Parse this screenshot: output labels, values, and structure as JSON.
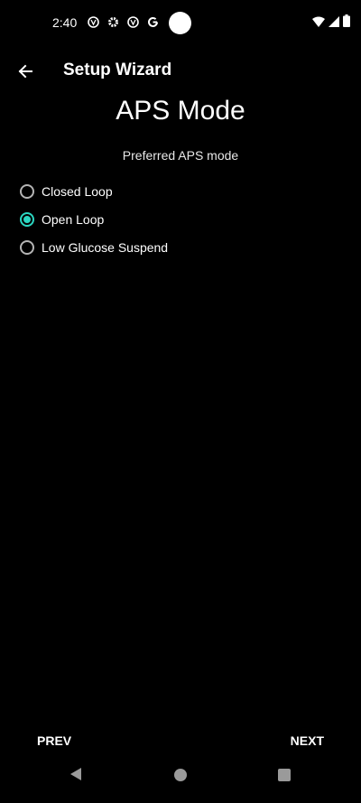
{
  "status_bar": {
    "time": "2:40",
    "left_icons": [
      "app-icon",
      "settings-icon",
      "app-icon",
      "google-icon"
    ],
    "right_icons": [
      "wifi-icon",
      "signal-icon",
      "battery-icon"
    ]
  },
  "app_bar": {
    "title": "Setup Wizard",
    "back_icon": "arrow-left-icon"
  },
  "page": {
    "title": "APS Mode",
    "subtitle": "Preferred APS mode",
    "options": [
      {
        "label": "Closed Loop",
        "checked": false
      },
      {
        "label": "Open Loop",
        "checked": true
      },
      {
        "label": "Low Glucose Suspend",
        "checked": false
      }
    ]
  },
  "footer": {
    "prev_label": "PREV",
    "next_label": "NEXT"
  },
  "nav_bar": {
    "icons": [
      "nav-back-icon",
      "nav-home-icon",
      "nav-recents-icon"
    ]
  },
  "colors": {
    "background": "#000000",
    "accent": "#2bd6c1",
    "text": "#ffffff",
    "radio_unchecked": "#b4b4b4"
  }
}
